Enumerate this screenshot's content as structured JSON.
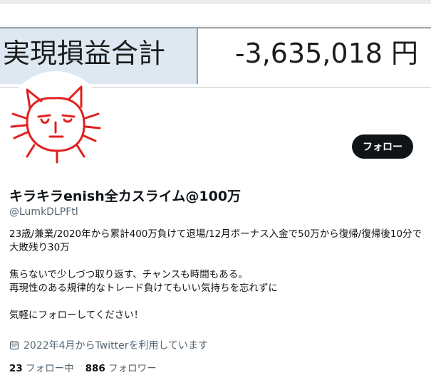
{
  "banner": {
    "label": "実現損益合計",
    "value": "-3,635,018 円"
  },
  "profile": {
    "follow_button": "フォロー",
    "display_name": "キラキラenish全カスライム@100万",
    "handle": "@LumkDLPFtl",
    "bio": [
      "23歳/兼業/2020年から累計400万負けて退場/12月ボーナス入金で50万から復帰/復帰後10分で大敗残り30万",
      "",
      "焦らないで少しづつ取り返す、チャンスも時間もある。",
      "再現性のある規律的なトレード負けてもいい気持ちを忘れずに",
      "",
      "気軽にフォローしてください！"
    ],
    "joined_icon": "calendar-icon",
    "joined": "2022年4月からTwitterを利用しています",
    "following_count": "23",
    "following_label": "フォロー中",
    "followers_count": "886",
    "followers_label": "フォロワー"
  },
  "colors": {
    "banner_label_bg": "#dde8f2",
    "follow_button_bg": "#0f1419",
    "avatar_drawing": "#e02020",
    "muted_text": "#536471"
  }
}
